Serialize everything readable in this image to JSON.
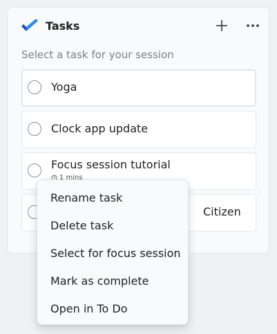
{
  "widget": {
    "title": "Tasks",
    "subtitle": "Select a task for your session",
    "add_icon": "plus-icon",
    "more_icon": "more-horizontal-icon",
    "accent_color": "#1f6fd6"
  },
  "tasks": [
    {
      "name": "Yoga"
    },
    {
      "name": "Clock app update"
    },
    {
      "name": "Focus session tutorial",
      "meta": "1 mins"
    },
    {
      "name": "Citizen"
    }
  ],
  "context_menu": {
    "items": [
      {
        "label": "Rename task"
      },
      {
        "label": "Delete task"
      },
      {
        "label": "Select for focus session"
      },
      {
        "label": "Mark as complete"
      },
      {
        "label": "Open in To Do"
      }
    ]
  }
}
